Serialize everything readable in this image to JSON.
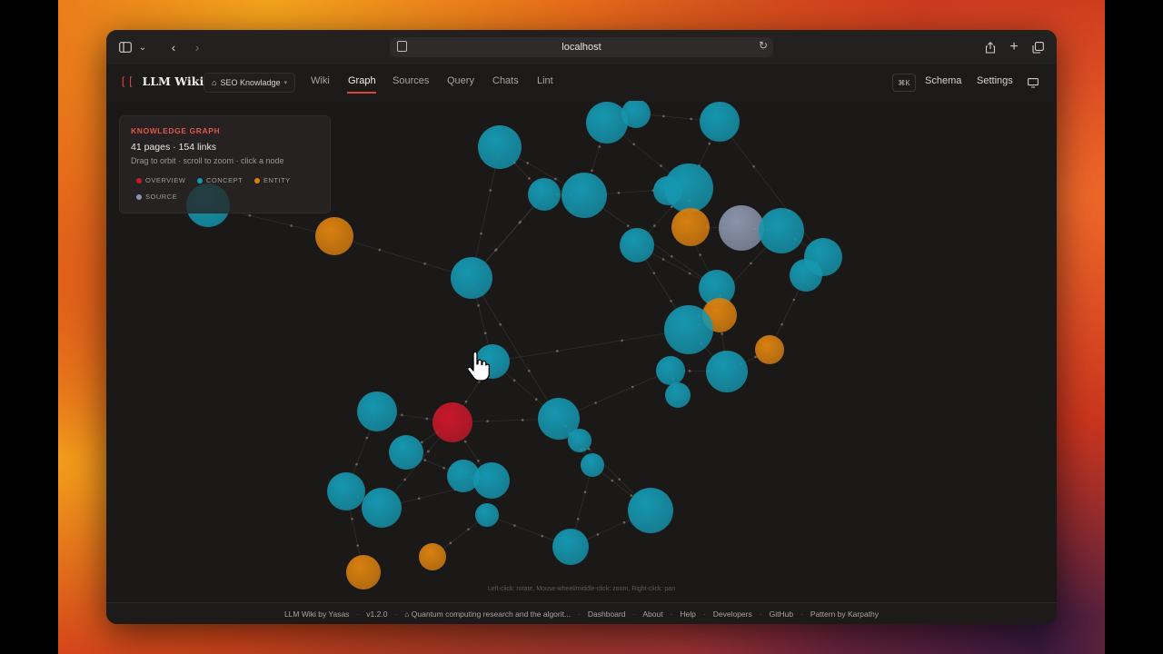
{
  "browser": {
    "url": "localhost"
  },
  "app": {
    "logo_mark": "[[",
    "name": "LLM Wiki",
    "knowledge_base": "SEO Knowladge",
    "nav": [
      {
        "label": "Wiki",
        "active": false
      },
      {
        "label": "Graph",
        "active": true
      },
      {
        "label": "Sources",
        "active": false
      },
      {
        "label": "Query",
        "active": false
      },
      {
        "label": "Chats",
        "active": false
      },
      {
        "label": "Lint",
        "active": false
      }
    ],
    "shortcut": "⌘K",
    "schema_label": "Schema",
    "settings_label": "Settings"
  },
  "graph_panel": {
    "title": "KNOWLEDGE GRAPH",
    "stats": "41 pages · 154 links",
    "hint": "Drag to orbit · scroll to zoom · click a node",
    "legend": [
      {
        "label": "OVERVIEW",
        "color": "#c8182a"
      },
      {
        "label": "CONCEPT",
        "color": "#1597b0"
      },
      {
        "label": "ENTITY",
        "color": "#d9800f"
      },
      {
        "label": "SOURCE",
        "color": "#8a93ab"
      }
    ]
  },
  "controls_hint": "Left-click: rotate, Mouse-wheel/middle-click: zoom, Right-click: pan",
  "footer": {
    "items": [
      "LLM Wiki by Yasas",
      "v1.2.0",
      "⌂ Quantum computing research and the algorit...",
      "Dashboard",
      "About",
      "Help",
      "Developers",
      "GitHub",
      "Pattern by Karpathy"
    ]
  },
  "colors": {
    "overview": "#c8182a",
    "concept": "#1597b0",
    "entity": "#d9800f",
    "source": "#8a93ab",
    "accent": "#d9453a"
  }
}
